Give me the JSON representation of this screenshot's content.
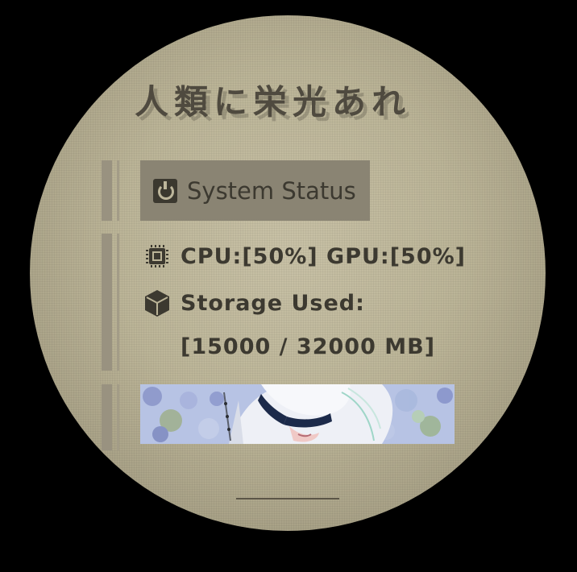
{
  "title": "人類に栄光あれ",
  "status": {
    "title": "System Status",
    "icon": "power-icon"
  },
  "metrics": {
    "usage_line": "CPU:[50%] GPU:[50%]",
    "cpu_icon": "cpu-chip-icon",
    "storage_icon": "storage-cube-icon",
    "storage_label": "Storage Used:",
    "storage_value": "[15000 / 32000 MB]"
  },
  "colors": {
    "face": "#bbb497",
    "text": "#3c3930",
    "header_bg": "#8a8473",
    "background": "#000000"
  }
}
